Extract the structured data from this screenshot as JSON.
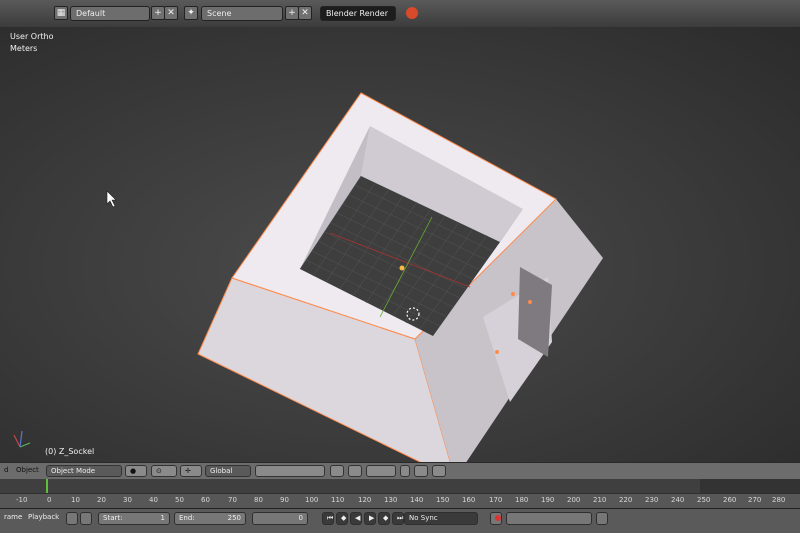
{
  "header": {
    "screen_layout": "Default",
    "scene": "Scene",
    "render_engine": "Blender Render",
    "add_symbol": "+",
    "close_symbol": "✕"
  },
  "viewport": {
    "view_label": "User Ortho",
    "units_label": "Meters",
    "object_label": "(0) Z_Sockel"
  },
  "toolbar": {
    "view_menu": "d",
    "object_menu": "Object",
    "mode": "Object Mode",
    "orientation": "Global"
  },
  "timeline": {
    "ticks": [
      "-10",
      "0",
      "10",
      "20",
      "30",
      "40",
      "50",
      "60",
      "70",
      "80",
      "90",
      "100",
      "110",
      "120",
      "130",
      "140",
      "150",
      "160",
      "170",
      "180",
      "190",
      "200",
      "210",
      "220",
      "230",
      "240",
      "250",
      "260",
      "270",
      "280"
    ]
  },
  "footer": {
    "frame_menu": "rame",
    "playback_menu": "Playback",
    "start_label": "Start:",
    "start_value": "1",
    "end_label": "End:",
    "end_value": "250",
    "current_frame": "0",
    "sync": "No Sync"
  },
  "colors": {
    "header_bg": "#4a4a4a",
    "viewport_bg": "#3d3d3d",
    "selection_outline": "#ff8a4a",
    "model_face": "#e9e5ea"
  }
}
